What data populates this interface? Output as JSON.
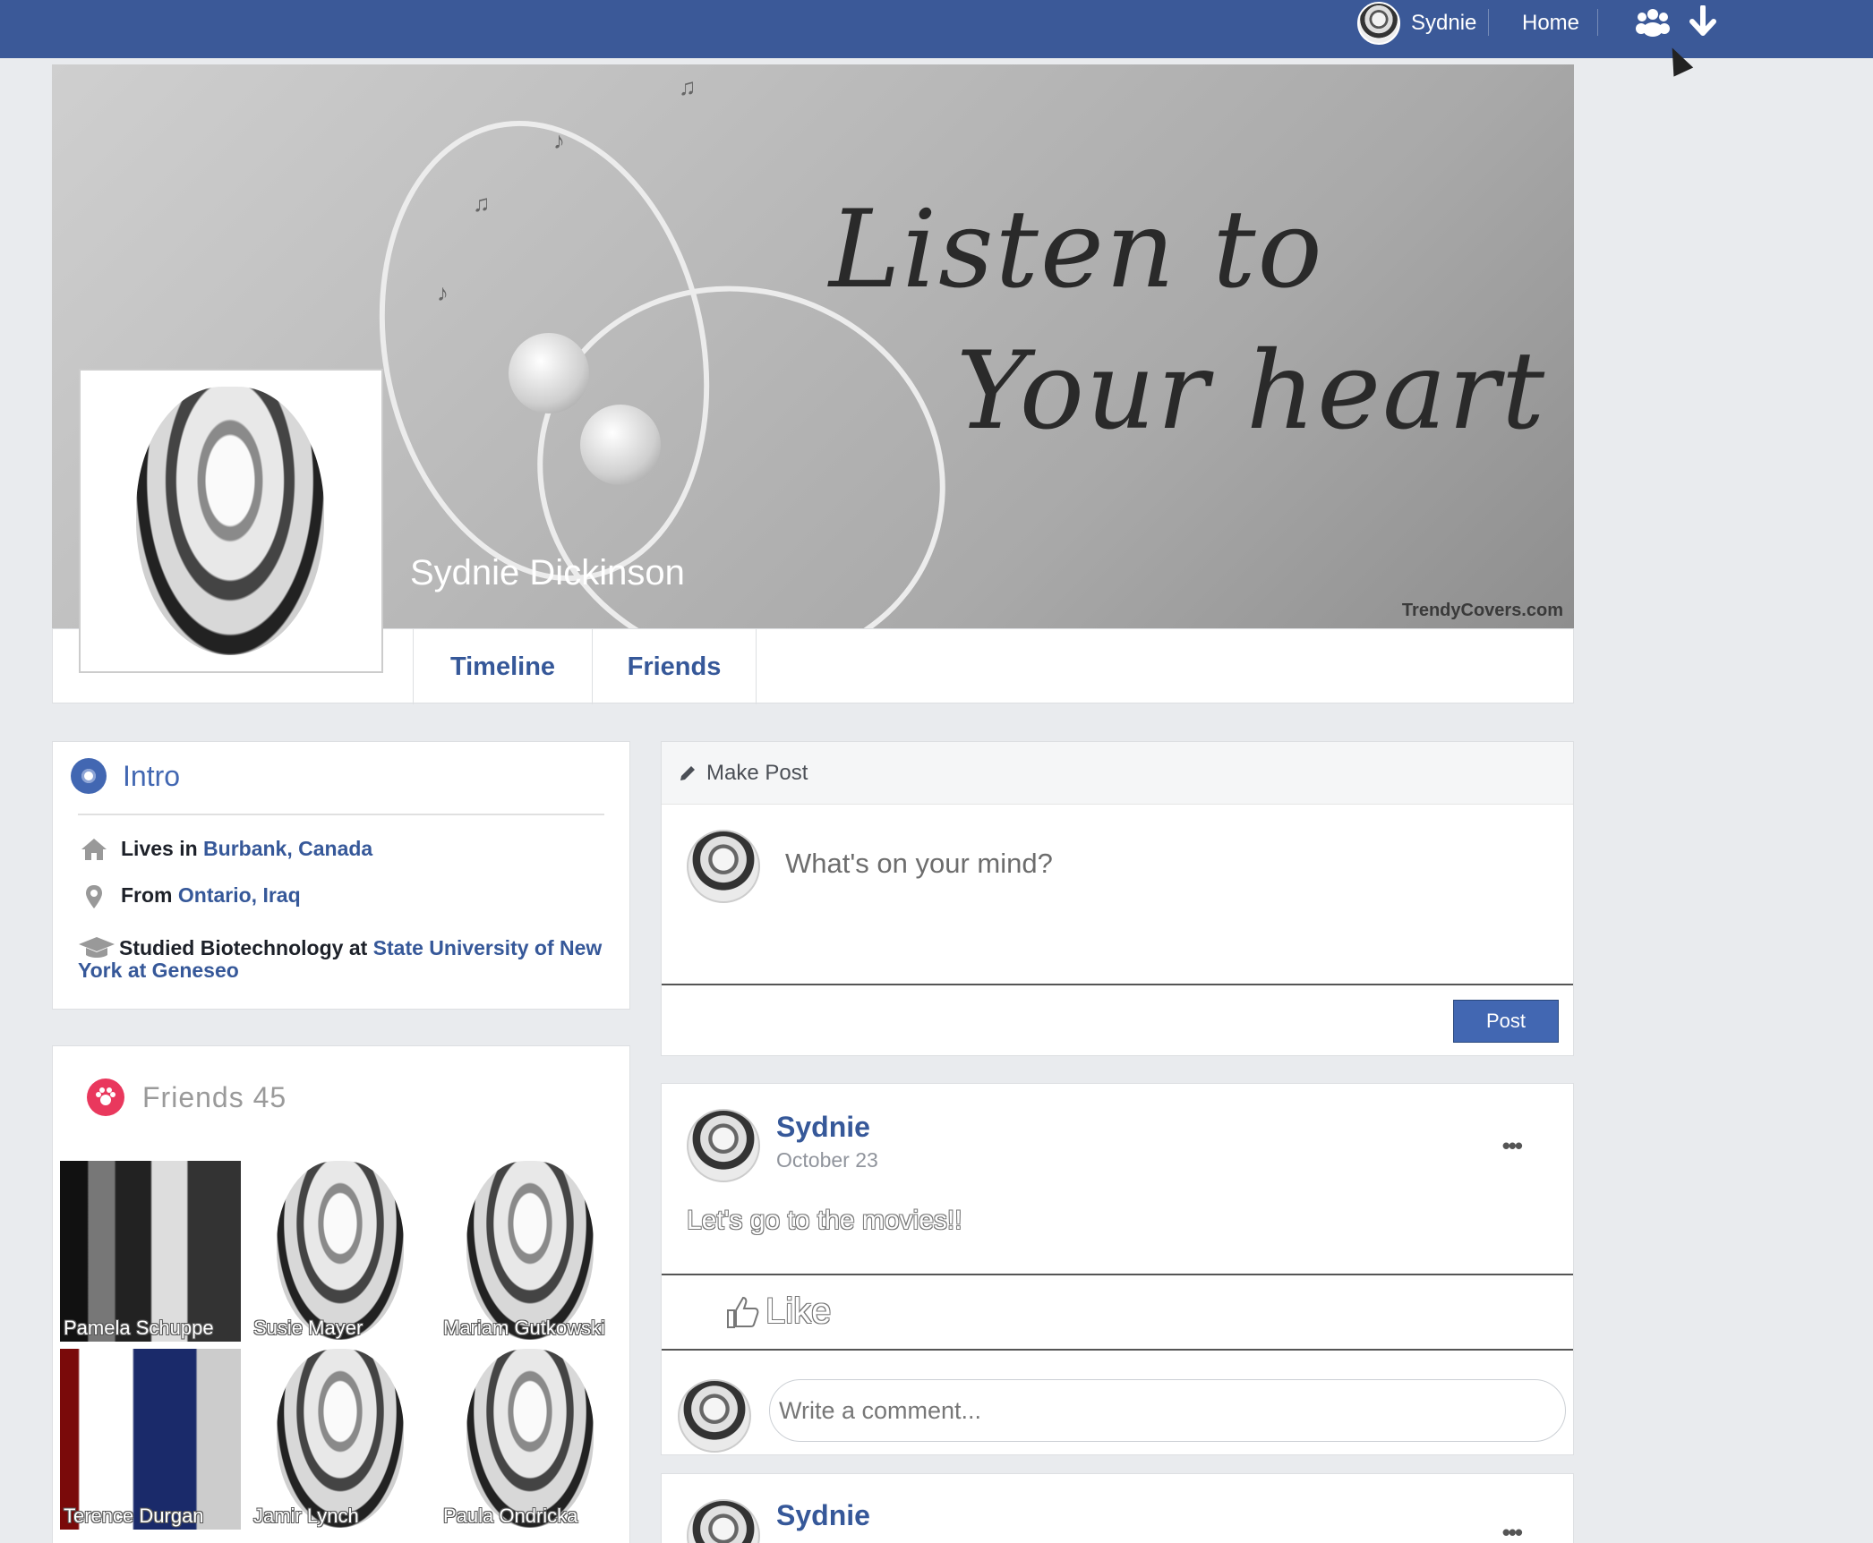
{
  "topbar": {
    "user_name": "Sydnie",
    "home_label": "Home",
    "friends_icon": "people-icon",
    "menu_icon": "arrow-down-icon"
  },
  "cover": {
    "script_line1": "Listen to",
    "script_line2": "Your heart",
    "watermark": "TrendyCovers.com",
    "profile_name": "Sydnie Dickinson"
  },
  "tabs": [
    {
      "label": "Timeline"
    },
    {
      "label": "Friends"
    }
  ],
  "intro": {
    "title": "Intro",
    "lives_prefix": "Lives in",
    "lives_place": "Burbank, Canada",
    "from_prefix": "From",
    "from_place": "Ontario, Iraq",
    "studied_prefix": "Studied Biotechnology at",
    "studied_school": "State University of New York at Geneseo"
  },
  "friends": {
    "title": "Friends 45",
    "items": [
      {
        "name": "Pamela Schuppe"
      },
      {
        "name": "Susie Mayer"
      },
      {
        "name": "Mariam Gutkowski"
      },
      {
        "name": "Terence Durgan"
      },
      {
        "name": "Jamir Lynch"
      },
      {
        "name": "Paula Ondricka"
      }
    ]
  },
  "make_post": {
    "header": "Make Post",
    "placeholder": "What's on your mind?",
    "post_button": "Post"
  },
  "posts": [
    {
      "author": "Sydnie",
      "date": "October 23",
      "text": "Let's go to the movies!!",
      "like_label": "Like",
      "comment_placeholder": "Write a comment...",
      "more": "•••"
    },
    {
      "author": "Sydnie",
      "more": "•••"
    }
  ],
  "colors": {
    "topbar": "#3b5998",
    "link": "#365899",
    "accent": "#4267b2",
    "friends_badge": "#e9385d"
  }
}
